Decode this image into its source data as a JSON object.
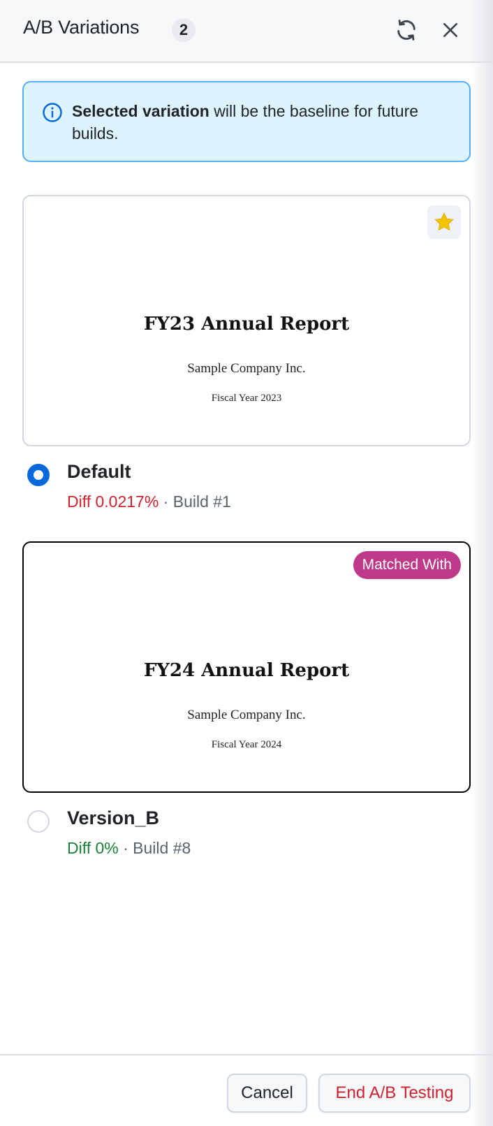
{
  "header": {
    "title": "A/B Variations",
    "count": "2",
    "refresh_icon": "refresh-icon",
    "close_icon": "close-icon"
  },
  "info_banner": {
    "icon": "info-icon",
    "bold_text": "Selected variation",
    "text": " will be the baseline for future builds."
  },
  "variations": [
    {
      "name": "Default",
      "selected": true,
      "diff": "Diff 0.0217%",
      "separator": " · ",
      "build": "Build #1",
      "diff_color": "#cf222e",
      "preview": {
        "title": "FY23 Annual Report",
        "company": "Sample Company Inc.",
        "year": "Fiscal Year 2023"
      },
      "star_icon": "star-icon"
    },
    {
      "name": "Version_B",
      "selected": false,
      "diff": "Diff 0%",
      "separator": " · ",
      "build": "Build #8",
      "diff_color": "#1a7f37",
      "preview": {
        "title": "FY24 Annual Report",
        "company": "Sample Company Inc.",
        "year": "Fiscal Year 2024"
      },
      "badge": "Matched With"
    }
  ],
  "footer": {
    "cancel_label": "Cancel",
    "end_label": "End A/B Testing"
  },
  "colors": {
    "accent": "#0969da",
    "danger": "#cf222e",
    "success": "#1a7f37",
    "matched_badge": "#bf3989",
    "star": "#f5c400"
  }
}
